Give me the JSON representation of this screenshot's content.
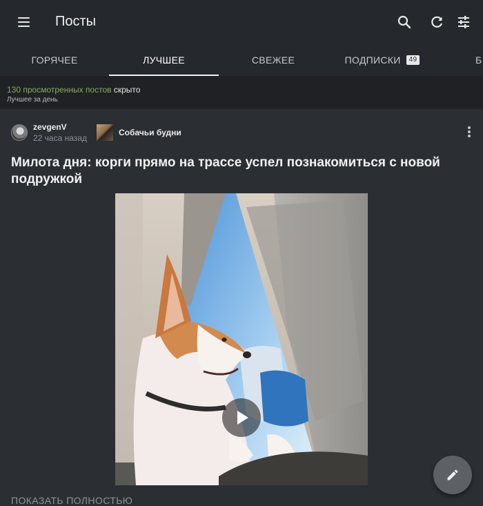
{
  "appbar": {
    "title": "Посты",
    "icons": [
      "menu-icon",
      "search-icon",
      "refresh-icon",
      "filter-sliders-icon"
    ]
  },
  "tabs": [
    {
      "label": "ГОРЯЧЕЕ",
      "active": false
    },
    {
      "label": "ЛУЧШЕЕ",
      "active": true
    },
    {
      "label": "СВЕЖЕЕ",
      "active": false
    },
    {
      "label": "ПОДПИСКИ",
      "active": false,
      "badge": "49"
    },
    {
      "label": "Б",
      "active": false
    }
  ],
  "notice": {
    "count_text": "130 просмотренных постов",
    "state_text": "скрыто",
    "subtitle": "Лучшее за день"
  },
  "post": {
    "author": "zevgenV",
    "time": "22 часа назад",
    "community": "Собачьи будни",
    "title": "Милота дня: корги прямо на трассе успел познакомиться с новой подружкой",
    "show_full": "ПОКАЗАТЬ ПОЛНОСТЬЮ"
  },
  "fab": {
    "icon": "pencil-icon"
  },
  "colors": {
    "appbar_bg": "#25282c",
    "page_bg": "#2b2e33",
    "notice_bg": "#1f2124",
    "notice_green": "#8cab63",
    "fab_bg": "#5d6166"
  }
}
